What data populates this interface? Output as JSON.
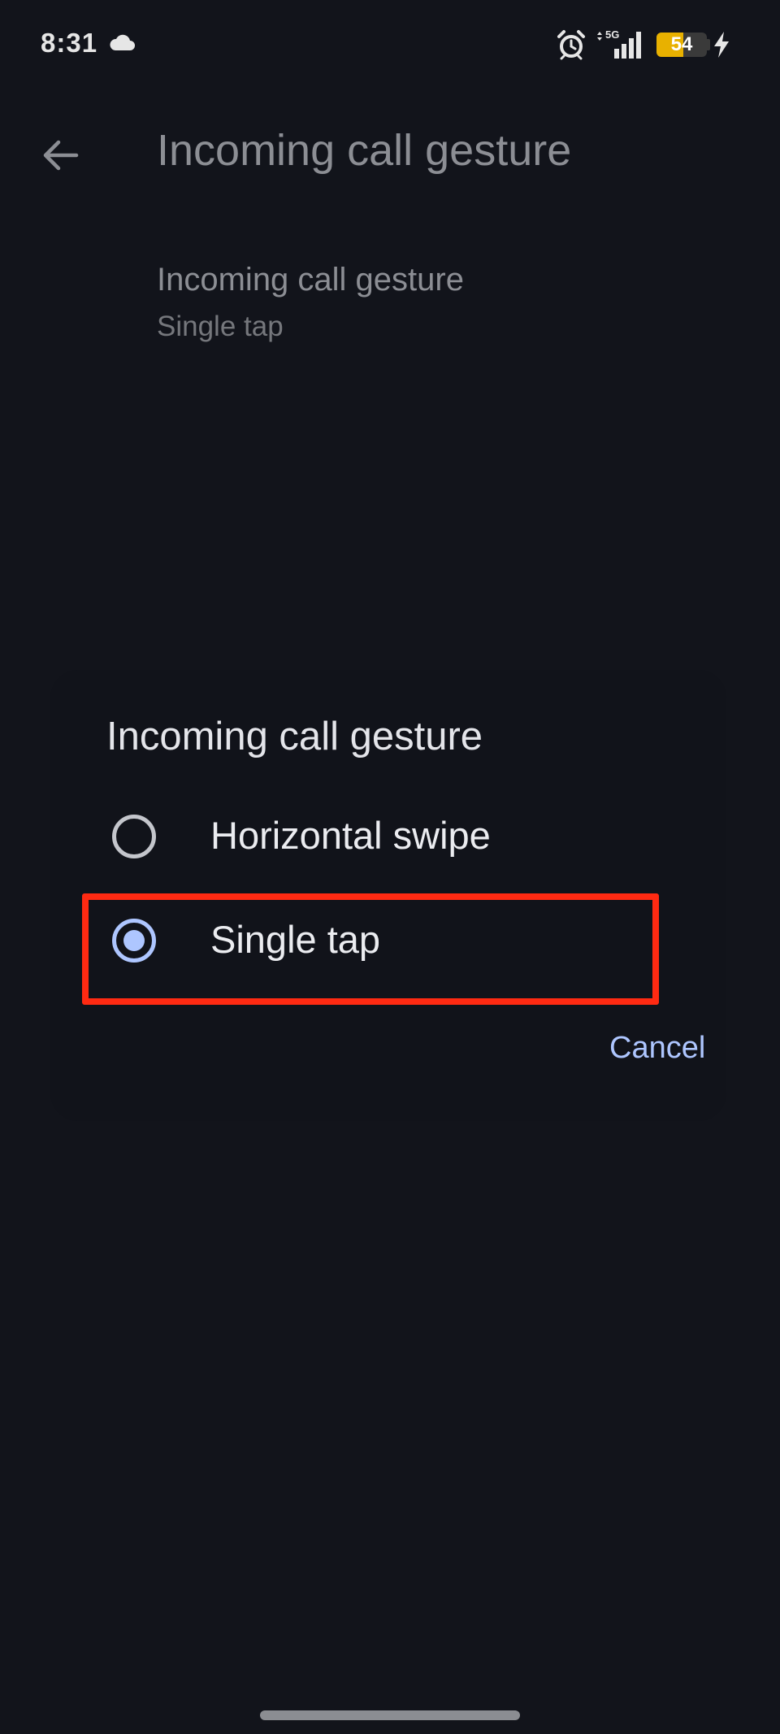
{
  "status_bar": {
    "time": "8:31",
    "battery_level": "54",
    "battery_fraction": 0.54,
    "network_label": "5G",
    "icons": [
      "cloud-icon",
      "alarm-icon",
      "signal-icon",
      "battery-icon",
      "charging-bolt-icon"
    ]
  },
  "page": {
    "title": "Incoming call gesture",
    "back_icon": "arrow-back-icon",
    "setting": {
      "title": "Incoming call gesture",
      "value": "Single tap"
    }
  },
  "dialog": {
    "title": "Incoming call gesture",
    "options": [
      {
        "label": "Horizontal swipe",
        "selected": false
      },
      {
        "label": "Single tap",
        "selected": true
      }
    ],
    "cancel_label": "Cancel"
  },
  "colors": {
    "background": "#12141b",
    "accent": "#aec6ff",
    "highlight": "#ff2a12",
    "battery": "#e8b100"
  }
}
